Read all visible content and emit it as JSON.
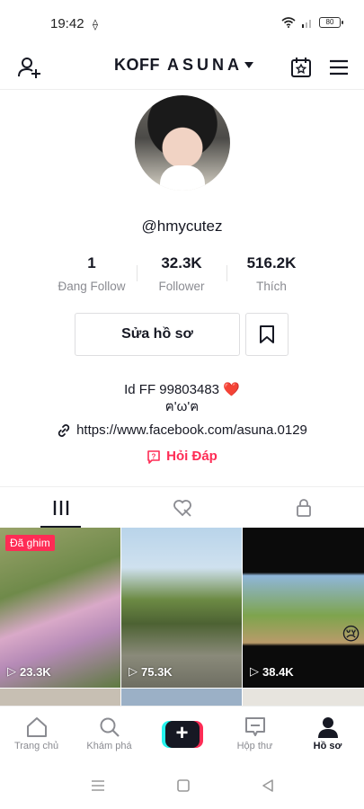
{
  "status_bar": {
    "time": "19:42",
    "battery": "80"
  },
  "header": {
    "name_part1": "KOFF",
    "name_part2": "ASUNA"
  },
  "profile": {
    "username": "@hmycutez",
    "stats": [
      {
        "value": "1",
        "label": "Đang Follow"
      },
      {
        "value": "32.3K",
        "label": "Follower"
      },
      {
        "value": "516.2K",
        "label": "Thích"
      }
    ],
    "edit_label": "Sửa hồ sơ",
    "bio_line1": "Id FF 99803483",
    "bio_heart": "❤️",
    "bio_line2": "ฅ'ω'ฅ",
    "link": "https://www.facebook.com/asuna.0129",
    "qa_label": "Hỏi Đáp"
  },
  "videos": [
    {
      "views": "23.3K",
      "pinned_label": "Đã ghim"
    },
    {
      "views": "75.3K"
    },
    {
      "views": "38.4K",
      "emoji": "😢"
    }
  ],
  "bottom_nav": [
    {
      "label": "Trang chủ",
      "icon": "home-icon"
    },
    {
      "label": "Khám phá",
      "icon": "search-icon"
    },
    {
      "label": "",
      "icon": "create-plus-icon"
    },
    {
      "label": "Hộp thư",
      "icon": "inbox-icon"
    },
    {
      "label": "Hồ sơ",
      "icon": "profile-icon"
    }
  ]
}
